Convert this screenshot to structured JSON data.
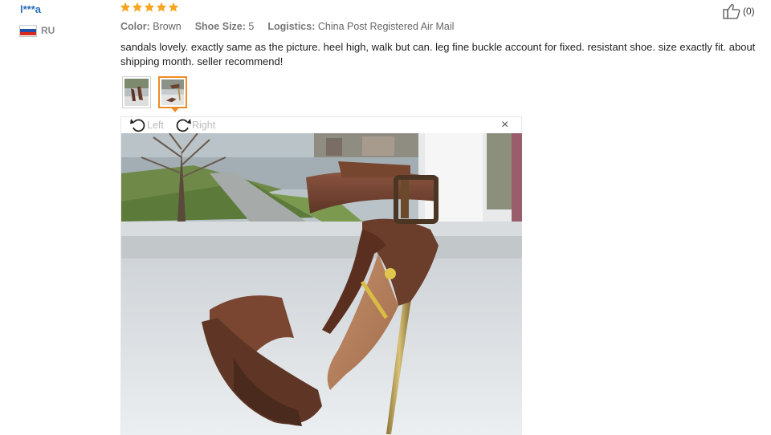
{
  "reviewer": {
    "name": "l***a",
    "country": "RU",
    "flag_colors": [
      "#ffffff",
      "#2451a8",
      "#d52b1e"
    ]
  },
  "rating": {
    "stars": 5,
    "max": 5,
    "star_color": "#f6a623"
  },
  "attributes": [
    {
      "label": "Color:",
      "value": "Brown"
    },
    {
      "label": "Shoe Size:",
      "value": "5"
    },
    {
      "label": "Logistics:",
      "value": "China Post Registered Air Mail"
    }
  ],
  "review_text": "sandals lovely. exactly same as the picture. heel high, walk but can. leg fine buckle account for fixed. resistant shoe. size exactly fit. about shipping month. seller recommend!",
  "helpful": {
    "icon": "thumbs-up-icon",
    "count": "(0)"
  },
  "thumbnails": {
    "count": 2,
    "active_index": 1,
    "accent": "#f08a24"
  },
  "viewer": {
    "rotate_left": "Left",
    "rotate_right": "Right",
    "close": "×"
  }
}
